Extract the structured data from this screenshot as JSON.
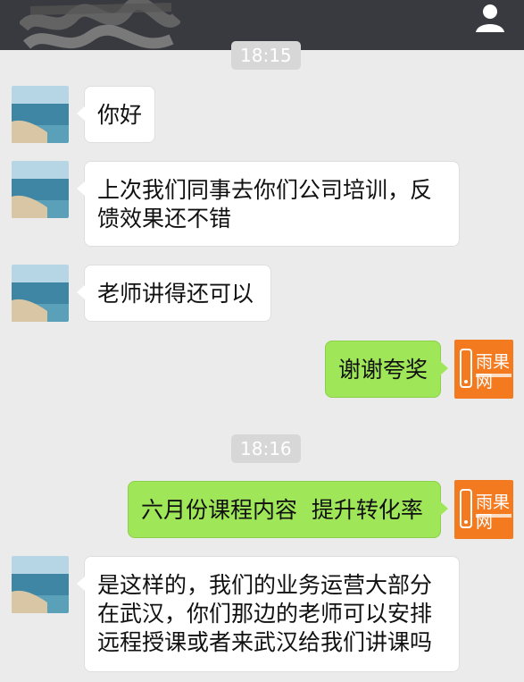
{
  "header": {
    "profile_icon": "person-icon"
  },
  "messages": [
    {
      "type": "time",
      "text": "18:15"
    },
    {
      "type": "in",
      "text": "你好"
    },
    {
      "type": "in",
      "lines": [
        "上次我们同事去你们公司培训，反",
        "馈效果还不错"
      ]
    },
    {
      "type": "in",
      "text": "老师讲得还可以"
    },
    {
      "type": "out",
      "text": "谢谢夸奖"
    },
    {
      "type": "time",
      "text": "18:16"
    },
    {
      "type": "out",
      "text": "六月份课程内容  提升转化率"
    },
    {
      "type": "in",
      "lines": [
        "是这样的，我们的业务运营大部分",
        "在武汉，你们那边的老师可以安排",
        "远程授课或者来武汉给我们讲课吗"
      ]
    }
  ],
  "brand": {
    "logo_text": "雨果网",
    "accent": "#f47a1f"
  },
  "colors": {
    "incoming_bubble": "#ffffff",
    "outgoing_bubble": "#9fe658",
    "background": "#ebebeb",
    "header": "#393a3f"
  }
}
